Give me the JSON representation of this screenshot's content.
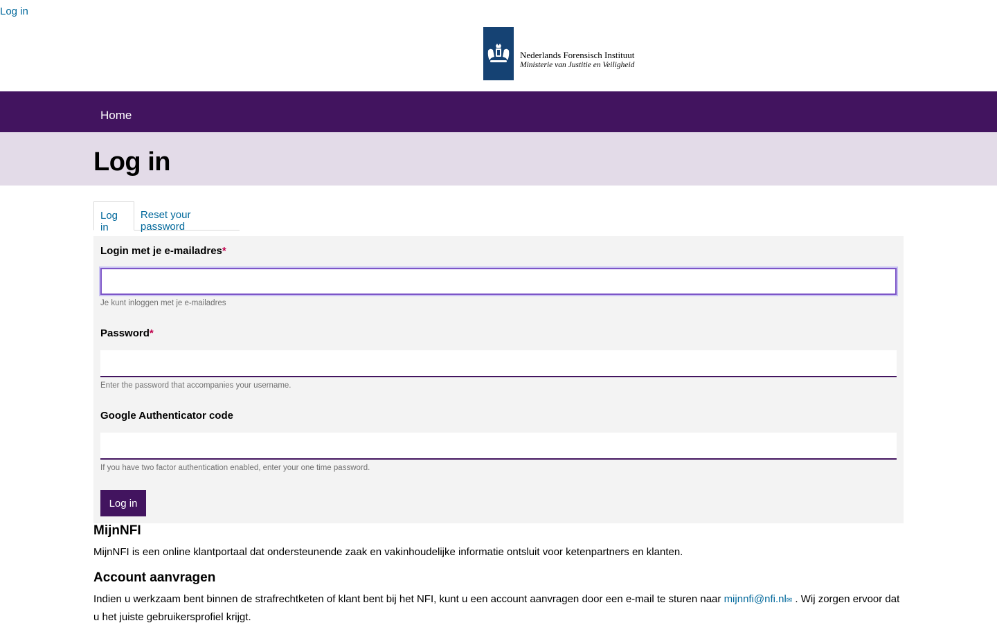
{
  "top": {
    "login_link": "Log in"
  },
  "logo": {
    "line1": "Nederlands Forensisch Instituut",
    "line2": "Ministerie van Justitie en Veiligheid",
    "brand_color": "#154273"
  },
  "nav": {
    "home": "Home",
    "bg_color": "#42145f"
  },
  "page": {
    "title": "Log in",
    "band_color": "#e3dbe8"
  },
  "tabs": [
    {
      "label": "Log in",
      "active": true
    },
    {
      "label": "Reset your password",
      "active": false
    }
  ],
  "form": {
    "email": {
      "label": "Login met je e-mailadres",
      "required_mark": "*",
      "value": "",
      "help": "Je kunt inloggen met je e-mailadres"
    },
    "password": {
      "label": "Password",
      "required_mark": "*",
      "value": "",
      "help": "Enter the password that accompanies your username."
    },
    "otp": {
      "label": "Google Authenticator code",
      "value": "",
      "help": "If you have two factor authentication enabled, enter your one time password."
    },
    "submit_label": "Log in"
  },
  "info": {
    "heading1": "MijnNFI",
    "text1": "MijnNFI is een online klantportaal dat ondersteunende zaak en vakinhoudelijke informatie ontsluit voor ketenpartners en klanten.",
    "heading2": "Account aanvragen",
    "text2_before": "Indien u werkzaam bent binnen de strafrechtketen of klant bent bij het NFI, kunt u een account aanvragen door een e-mail te sturen naar ",
    "email_link": "mijnnfi@nfi.nl",
    "text2_after": " . Wij zorgen ervoor dat u het juiste gebruikersprofiel krijgt."
  },
  "icons": {
    "crest": "royal-crest-icon",
    "mail": "envelope-icon"
  }
}
